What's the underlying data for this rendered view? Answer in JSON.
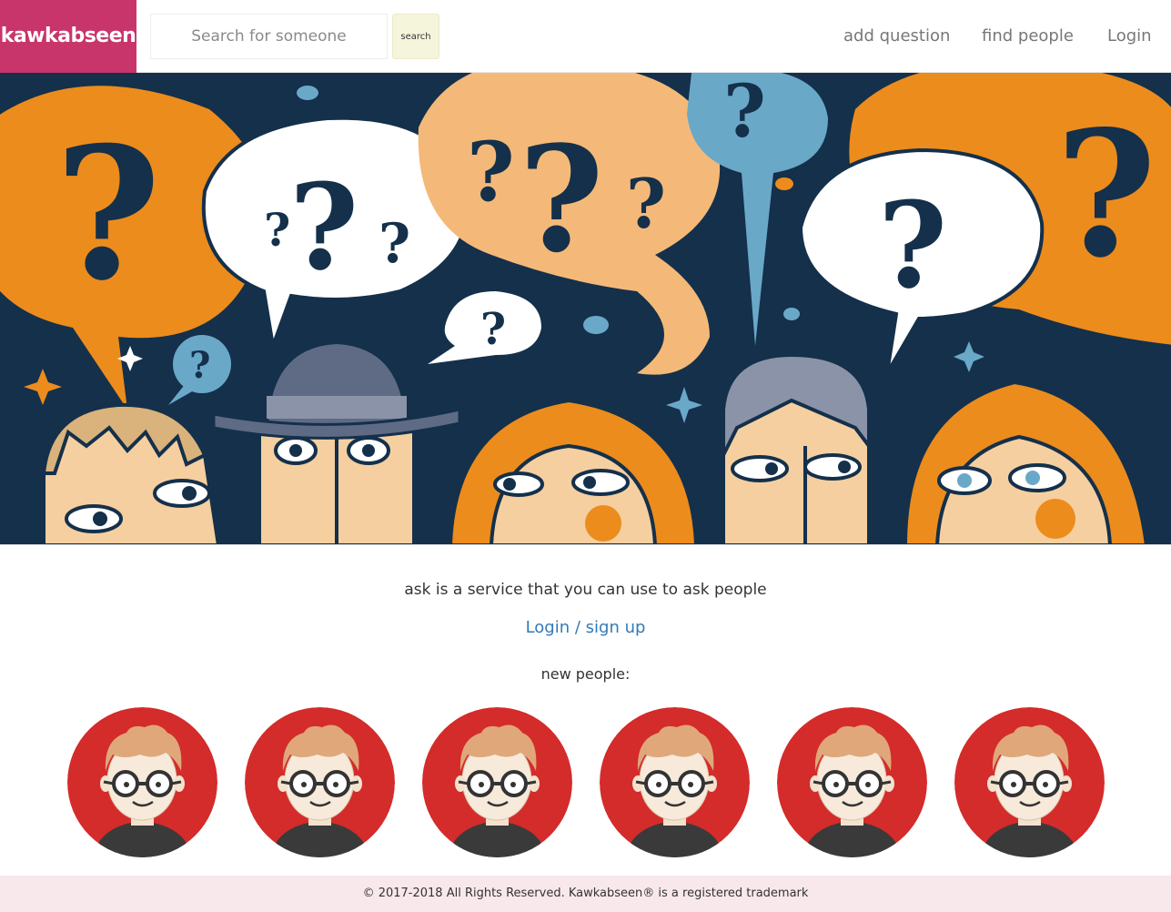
{
  "nav": {
    "brand": "kawkabseen",
    "search_placeholder": "Search for someone",
    "search_button": "search",
    "links": [
      "add question",
      "find people",
      "Login"
    ]
  },
  "hero": {
    "image": "people-with-question-mark-speech-bubbles-illustration"
  },
  "main": {
    "tagline": "ask is a service that you can use to ask people",
    "login_signup": "Login / sign up",
    "new_people_label": "new people:",
    "avatar_count": 6,
    "avatar_icon": "cartoon-person-with-glasses-avatar"
  },
  "footer": {
    "copyright": "© 2017-2018 All Rights Reserved. Kawkabseen® is a registered trademark"
  },
  "colors": {
    "brand": "#c8356b",
    "search_button": "#f5f5dc",
    "link": "#337ab7",
    "footer_bg": "#f8e8ec",
    "hero_bg": "#14304b",
    "hero_orange": "#ec8c1c",
    "hero_peach": "#f4b978",
    "hero_blue": "#6aa8c8",
    "avatar_bg": "#d42b2b"
  }
}
